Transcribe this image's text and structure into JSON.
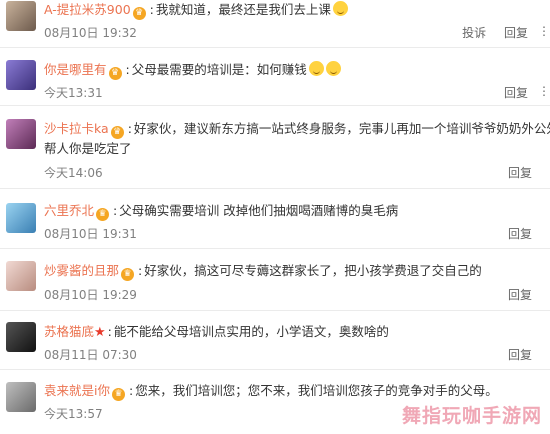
{
  "comments": [
    {
      "user": "A-提拉米苏900",
      "badge": "crown",
      "text": "我就知道，最终还是我们去上课",
      "emoji": true,
      "time": "08月10日 19:32",
      "actions": [
        "投诉",
        "回复"
      ]
    },
    {
      "user": "你是哪里有",
      "badge": "crown",
      "text": "父母最需要的培训是：如何赚钱",
      "emoji": true,
      "time": "今天13:31",
      "actions": [
        "回复"
      ]
    },
    {
      "user": "沙卡拉卡ka",
      "badge": "crown",
      "text": "好家伙，建议新东方搞一站式终身服务，完事儿再加一个培训爷爷奶奶外公外婆",
      "text2": "帮人你是吃定了",
      "time": "今天14:06",
      "actions": [
        "回复"
      ]
    },
    {
      "user": "六里乔北",
      "badge": "crown",
      "text": "父母确实需要培训 改掉他们抽烟喝酒赌博的臭毛病",
      "time": "08月10日 19:31",
      "actions": [
        "回复"
      ]
    },
    {
      "user": "炒雾酱的且那",
      "badge": "crown",
      "text": "好家伙，搞这可尽专薅这群家长了，把小孩学费退了交自己的",
      "time": "08月10日 19:29",
      "actions": [
        "回复"
      ]
    },
    {
      "user": "苏格猫底",
      "badge": "star",
      "text": "能不能给父母培训点实用的，小学语文，奥数啥的",
      "time": "08月11日 07:30",
      "actions": [
        "回复"
      ]
    },
    {
      "user": "袁来就是i你",
      "badge": "crown",
      "text": "您来，我们培训您；您不来，我们培训您孩子的竞争对手的父母。",
      "time": "今天13:57",
      "actions": []
    }
  ],
  "watermark": "舞指玩咖手游网",
  "colors": {
    "username": "#eb7350",
    "time": "#808080",
    "badge": "#f5a623"
  }
}
